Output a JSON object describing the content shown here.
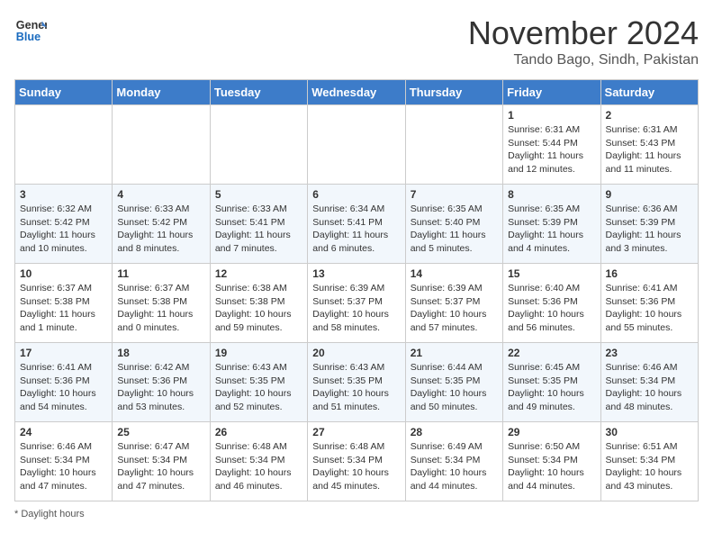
{
  "header": {
    "logo_line1": "General",
    "logo_line2": "Blue",
    "month": "November 2024",
    "location": "Tando Bago, Sindh, Pakistan"
  },
  "weekdays": [
    "Sunday",
    "Monday",
    "Tuesday",
    "Wednesday",
    "Thursday",
    "Friday",
    "Saturday"
  ],
  "rows": [
    [
      {
        "day": "",
        "info": ""
      },
      {
        "day": "",
        "info": ""
      },
      {
        "day": "",
        "info": ""
      },
      {
        "day": "",
        "info": ""
      },
      {
        "day": "",
        "info": ""
      },
      {
        "day": "1",
        "info": "Sunrise: 6:31 AM\nSunset: 5:44 PM\nDaylight: 11 hours and 12 minutes."
      },
      {
        "day": "2",
        "info": "Sunrise: 6:31 AM\nSunset: 5:43 PM\nDaylight: 11 hours and 11 minutes."
      }
    ],
    [
      {
        "day": "3",
        "info": "Sunrise: 6:32 AM\nSunset: 5:42 PM\nDaylight: 11 hours and 10 minutes."
      },
      {
        "day": "4",
        "info": "Sunrise: 6:33 AM\nSunset: 5:42 PM\nDaylight: 11 hours and 8 minutes."
      },
      {
        "day": "5",
        "info": "Sunrise: 6:33 AM\nSunset: 5:41 PM\nDaylight: 11 hours and 7 minutes."
      },
      {
        "day": "6",
        "info": "Sunrise: 6:34 AM\nSunset: 5:41 PM\nDaylight: 11 hours and 6 minutes."
      },
      {
        "day": "7",
        "info": "Sunrise: 6:35 AM\nSunset: 5:40 PM\nDaylight: 11 hours and 5 minutes."
      },
      {
        "day": "8",
        "info": "Sunrise: 6:35 AM\nSunset: 5:39 PM\nDaylight: 11 hours and 4 minutes."
      },
      {
        "day": "9",
        "info": "Sunrise: 6:36 AM\nSunset: 5:39 PM\nDaylight: 11 hours and 3 minutes."
      }
    ],
    [
      {
        "day": "10",
        "info": "Sunrise: 6:37 AM\nSunset: 5:38 PM\nDaylight: 11 hours and 1 minute."
      },
      {
        "day": "11",
        "info": "Sunrise: 6:37 AM\nSunset: 5:38 PM\nDaylight: 11 hours and 0 minutes."
      },
      {
        "day": "12",
        "info": "Sunrise: 6:38 AM\nSunset: 5:38 PM\nDaylight: 10 hours and 59 minutes."
      },
      {
        "day": "13",
        "info": "Sunrise: 6:39 AM\nSunset: 5:37 PM\nDaylight: 10 hours and 58 minutes."
      },
      {
        "day": "14",
        "info": "Sunrise: 6:39 AM\nSunset: 5:37 PM\nDaylight: 10 hours and 57 minutes."
      },
      {
        "day": "15",
        "info": "Sunrise: 6:40 AM\nSunset: 5:36 PM\nDaylight: 10 hours and 56 minutes."
      },
      {
        "day": "16",
        "info": "Sunrise: 6:41 AM\nSunset: 5:36 PM\nDaylight: 10 hours and 55 minutes."
      }
    ],
    [
      {
        "day": "17",
        "info": "Sunrise: 6:41 AM\nSunset: 5:36 PM\nDaylight: 10 hours and 54 minutes."
      },
      {
        "day": "18",
        "info": "Sunrise: 6:42 AM\nSunset: 5:36 PM\nDaylight: 10 hours and 53 minutes."
      },
      {
        "day": "19",
        "info": "Sunrise: 6:43 AM\nSunset: 5:35 PM\nDaylight: 10 hours and 52 minutes."
      },
      {
        "day": "20",
        "info": "Sunrise: 6:43 AM\nSunset: 5:35 PM\nDaylight: 10 hours and 51 minutes."
      },
      {
        "day": "21",
        "info": "Sunrise: 6:44 AM\nSunset: 5:35 PM\nDaylight: 10 hours and 50 minutes."
      },
      {
        "day": "22",
        "info": "Sunrise: 6:45 AM\nSunset: 5:35 PM\nDaylight: 10 hours and 49 minutes."
      },
      {
        "day": "23",
        "info": "Sunrise: 6:46 AM\nSunset: 5:34 PM\nDaylight: 10 hours and 48 minutes."
      }
    ],
    [
      {
        "day": "24",
        "info": "Sunrise: 6:46 AM\nSunset: 5:34 PM\nDaylight: 10 hours and 47 minutes."
      },
      {
        "day": "25",
        "info": "Sunrise: 6:47 AM\nSunset: 5:34 PM\nDaylight: 10 hours and 47 minutes."
      },
      {
        "day": "26",
        "info": "Sunrise: 6:48 AM\nSunset: 5:34 PM\nDaylight: 10 hours and 46 minutes."
      },
      {
        "day": "27",
        "info": "Sunrise: 6:48 AM\nSunset: 5:34 PM\nDaylight: 10 hours and 45 minutes."
      },
      {
        "day": "28",
        "info": "Sunrise: 6:49 AM\nSunset: 5:34 PM\nDaylight: 10 hours and 44 minutes."
      },
      {
        "day": "29",
        "info": "Sunrise: 6:50 AM\nSunset: 5:34 PM\nDaylight: 10 hours and 44 minutes."
      },
      {
        "day": "30",
        "info": "Sunrise: 6:51 AM\nSunset: 5:34 PM\nDaylight: 10 hours and 43 minutes."
      }
    ]
  ],
  "footer": {
    "note": "Daylight hours"
  }
}
